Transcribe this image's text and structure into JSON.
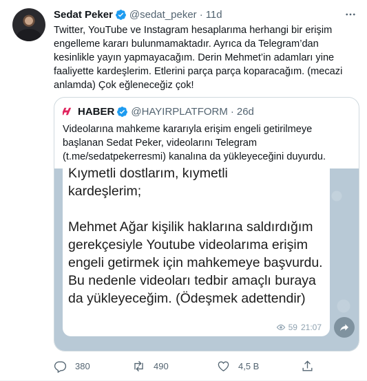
{
  "tweet": {
    "name": "Sedat Peker",
    "handle": "@sedat_peker",
    "separator": "·",
    "time": "11d",
    "text": "Twitter, YouTube ve Instagram hesaplarıma herhangi bir erişim engelleme kararı bulunmamaktadır. Ayrıca da Telegram’dan kesinlikle yayın yapmayacağım. Derin Mehmet’in adamları yine faaliyette kardeşlerim. Etlerini parça parça koparacağım. (mecazi anlamda) Çok eğleneceğiz çok!"
  },
  "quote": {
    "name": "HABER",
    "handle": "@HAYIRPLATFORM",
    "separator": "·",
    "time": "26d",
    "text": "Videolarına mahkeme kararıyla erişim engeli getirilmeye başlanan Sedat Peker, videolarını Telegram (t.me/sedatpekerresmi) kanalına da yükleyeceğini duyurdu.",
    "media": {
      "message_line1": "Kıymetli dostlarım, kıymetli",
      "message_line2": "kardeşlerim;",
      "message_body": "Mehmet Ağar kişilik haklarına saldırdığım gerekçesiyle Youtube videolarıma erişim engeli getirmek için mahkemeye başvurdu. Bu nedenle videoları tedbir amaçlı buraya da yükleyeceğim. (Ödeşmek adettendir)",
      "views": "59",
      "time": "21:07"
    }
  },
  "actions": {
    "replies": "380",
    "retweets": "490",
    "likes": "4,5 B",
    "share": ""
  },
  "colors": {
    "verified": "#1d9bf0",
    "haber_logo": "#e0245e",
    "muted_text": "#536471",
    "border": "#cfd9de"
  },
  "icons": [
    "verified-badge-icon",
    "more-icon",
    "haber-logo-icon",
    "eye-icon",
    "share-arrow-icon",
    "reply-icon",
    "retweet-icon",
    "like-icon",
    "share-icon"
  ]
}
